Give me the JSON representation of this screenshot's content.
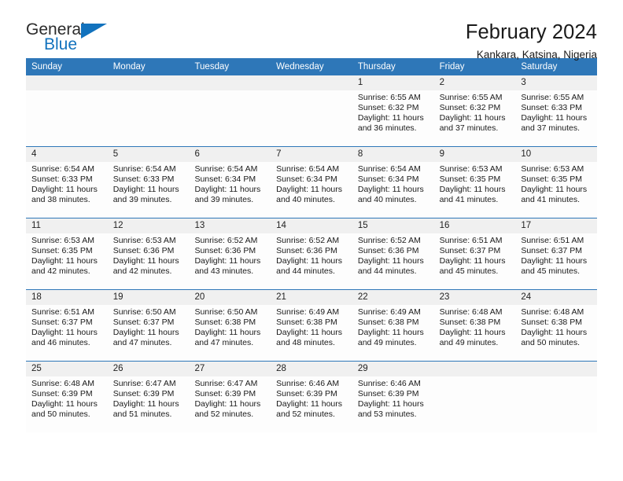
{
  "logo": {
    "word_top": "General",
    "word_bottom": "Blue",
    "accent_color": "#1272bd"
  },
  "header": {
    "title": "February 2024",
    "subtitle": "Kankara, Katsina, Nigeria"
  },
  "calendar": {
    "header_bg": "#2e77b8",
    "daynum_bg": "#f0f0f0",
    "weekdays": [
      "Sunday",
      "Monday",
      "Tuesday",
      "Wednesday",
      "Thursday",
      "Friday",
      "Saturday"
    ],
    "weeks": [
      [
        {
          "day": "",
          "lines": []
        },
        {
          "day": "",
          "lines": []
        },
        {
          "day": "",
          "lines": []
        },
        {
          "day": "",
          "lines": []
        },
        {
          "day": "1",
          "lines": [
            "Sunrise: 6:55 AM",
            "Sunset: 6:32 PM",
            "Daylight: 11 hours",
            "and 36 minutes."
          ]
        },
        {
          "day": "2",
          "lines": [
            "Sunrise: 6:55 AM",
            "Sunset: 6:32 PM",
            "Daylight: 11 hours",
            "and 37 minutes."
          ]
        },
        {
          "day": "3",
          "lines": [
            "Sunrise: 6:55 AM",
            "Sunset: 6:33 PM",
            "Daylight: 11 hours",
            "and 37 minutes."
          ]
        }
      ],
      [
        {
          "day": "4",
          "lines": [
            "Sunrise: 6:54 AM",
            "Sunset: 6:33 PM",
            "Daylight: 11 hours",
            "and 38 minutes."
          ]
        },
        {
          "day": "5",
          "lines": [
            "Sunrise: 6:54 AM",
            "Sunset: 6:33 PM",
            "Daylight: 11 hours",
            "and 39 minutes."
          ]
        },
        {
          "day": "6",
          "lines": [
            "Sunrise: 6:54 AM",
            "Sunset: 6:34 PM",
            "Daylight: 11 hours",
            "and 39 minutes."
          ]
        },
        {
          "day": "7",
          "lines": [
            "Sunrise: 6:54 AM",
            "Sunset: 6:34 PM",
            "Daylight: 11 hours",
            "and 40 minutes."
          ]
        },
        {
          "day": "8",
          "lines": [
            "Sunrise: 6:54 AM",
            "Sunset: 6:34 PM",
            "Daylight: 11 hours",
            "and 40 minutes."
          ]
        },
        {
          "day": "9",
          "lines": [
            "Sunrise: 6:53 AM",
            "Sunset: 6:35 PM",
            "Daylight: 11 hours",
            "and 41 minutes."
          ]
        },
        {
          "day": "10",
          "lines": [
            "Sunrise: 6:53 AM",
            "Sunset: 6:35 PM",
            "Daylight: 11 hours",
            "and 41 minutes."
          ]
        }
      ],
      [
        {
          "day": "11",
          "lines": [
            "Sunrise: 6:53 AM",
            "Sunset: 6:35 PM",
            "Daylight: 11 hours",
            "and 42 minutes."
          ]
        },
        {
          "day": "12",
          "lines": [
            "Sunrise: 6:53 AM",
            "Sunset: 6:36 PM",
            "Daylight: 11 hours",
            "and 42 minutes."
          ]
        },
        {
          "day": "13",
          "lines": [
            "Sunrise: 6:52 AM",
            "Sunset: 6:36 PM",
            "Daylight: 11 hours",
            "and 43 minutes."
          ]
        },
        {
          "day": "14",
          "lines": [
            "Sunrise: 6:52 AM",
            "Sunset: 6:36 PM",
            "Daylight: 11 hours",
            "and 44 minutes."
          ]
        },
        {
          "day": "15",
          "lines": [
            "Sunrise: 6:52 AM",
            "Sunset: 6:36 PM",
            "Daylight: 11 hours",
            "and 44 minutes."
          ]
        },
        {
          "day": "16",
          "lines": [
            "Sunrise: 6:51 AM",
            "Sunset: 6:37 PM",
            "Daylight: 11 hours",
            "and 45 minutes."
          ]
        },
        {
          "day": "17",
          "lines": [
            "Sunrise: 6:51 AM",
            "Sunset: 6:37 PM",
            "Daylight: 11 hours",
            "and 45 minutes."
          ]
        }
      ],
      [
        {
          "day": "18",
          "lines": [
            "Sunrise: 6:51 AM",
            "Sunset: 6:37 PM",
            "Daylight: 11 hours",
            "and 46 minutes."
          ]
        },
        {
          "day": "19",
          "lines": [
            "Sunrise: 6:50 AM",
            "Sunset: 6:37 PM",
            "Daylight: 11 hours",
            "and 47 minutes."
          ]
        },
        {
          "day": "20",
          "lines": [
            "Sunrise: 6:50 AM",
            "Sunset: 6:38 PM",
            "Daylight: 11 hours",
            "and 47 minutes."
          ]
        },
        {
          "day": "21",
          "lines": [
            "Sunrise: 6:49 AM",
            "Sunset: 6:38 PM",
            "Daylight: 11 hours",
            "and 48 minutes."
          ]
        },
        {
          "day": "22",
          "lines": [
            "Sunrise: 6:49 AM",
            "Sunset: 6:38 PM",
            "Daylight: 11 hours",
            "and 49 minutes."
          ]
        },
        {
          "day": "23",
          "lines": [
            "Sunrise: 6:48 AM",
            "Sunset: 6:38 PM",
            "Daylight: 11 hours",
            "and 49 minutes."
          ]
        },
        {
          "day": "24",
          "lines": [
            "Sunrise: 6:48 AM",
            "Sunset: 6:38 PM",
            "Daylight: 11 hours",
            "and 50 minutes."
          ]
        }
      ],
      [
        {
          "day": "25",
          "lines": [
            "Sunrise: 6:48 AM",
            "Sunset: 6:39 PM",
            "Daylight: 11 hours",
            "and 50 minutes."
          ]
        },
        {
          "day": "26",
          "lines": [
            "Sunrise: 6:47 AM",
            "Sunset: 6:39 PM",
            "Daylight: 11 hours",
            "and 51 minutes."
          ]
        },
        {
          "day": "27",
          "lines": [
            "Sunrise: 6:47 AM",
            "Sunset: 6:39 PM",
            "Daylight: 11 hours",
            "and 52 minutes."
          ]
        },
        {
          "day": "28",
          "lines": [
            "Sunrise: 6:46 AM",
            "Sunset: 6:39 PM",
            "Daylight: 11 hours",
            "and 52 minutes."
          ]
        },
        {
          "day": "29",
          "lines": [
            "Sunrise: 6:46 AM",
            "Sunset: 6:39 PM",
            "Daylight: 11 hours",
            "and 53 minutes."
          ]
        },
        {
          "day": "",
          "lines": []
        },
        {
          "day": "",
          "lines": []
        }
      ]
    ]
  }
}
